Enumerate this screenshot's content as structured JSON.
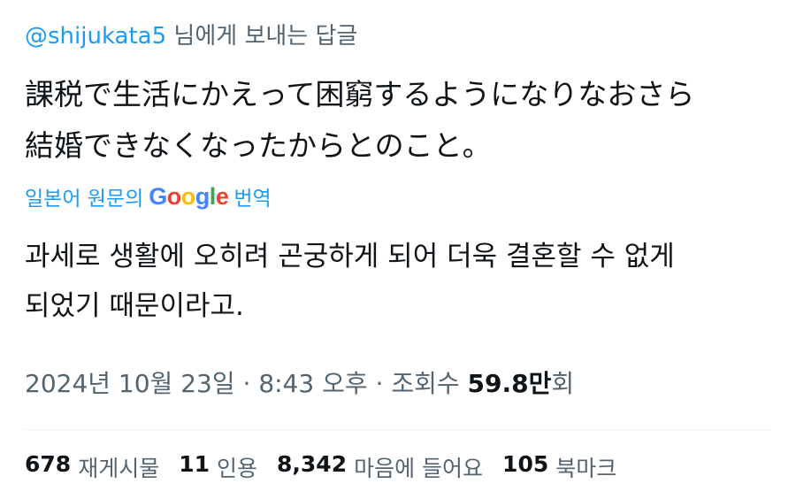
{
  "reply": {
    "handle": "@shijukata5",
    "suffix": " 님에게 보내는 답글"
  },
  "tweet": {
    "text_line1": "課税で生活にかえって困窮するようになりなおさら",
    "text_line2": "結婚できなくなったからとのこと。"
  },
  "translation": {
    "prefix": "일본어 원문의",
    "logo_letters": [
      "G",
      "o",
      "o",
      "g",
      "l",
      "e"
    ],
    "suffix": "번역",
    "text_line1": "과세로 생활에 오히려 곤궁하게 되어 더욱 결혼할 수 없게",
    "text_line2": "되었기 때문이라고."
  },
  "meta": {
    "date": "2024년 10월 23일",
    "sep1": " · ",
    "time": "8:43 오후",
    "sep2": " · ",
    "views_label": "조회수 ",
    "views_count": "59.8만",
    "views_suffix": "회"
  },
  "stats": {
    "reposts_count": "678",
    "reposts_label": "재게시물",
    "quotes_count": "11",
    "quotes_label": "인용",
    "likes_count": "8,342",
    "likes_label": "마음에 들어요",
    "bookmarks_count": "105",
    "bookmarks_label": "북마크"
  },
  "colors": {
    "link": "#1d9bf0",
    "secondary_text": "#536471",
    "primary_text": "#0f1419"
  }
}
